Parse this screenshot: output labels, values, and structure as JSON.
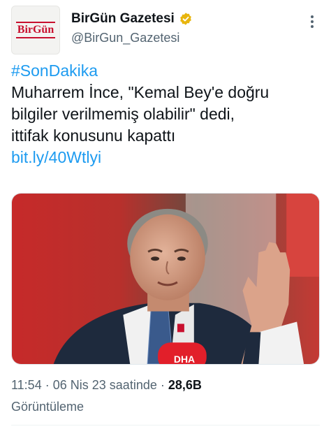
{
  "account": {
    "avatar_text": "BirGün",
    "display_name": "BirGün Gazetesi",
    "handle": "@BirGun_Gazetesi",
    "verified_color": "#e8b50d"
  },
  "tweet": {
    "hashtag": "#SonDakika",
    "lines": [
      "Muharrem İnce, \"Kemal Bey'e doğru",
      "bilgiler verilmemiş olabilir\" dedi,",
      "ittifak konusunu kapattı"
    ],
    "link": "bit.ly/40Wtlyi"
  },
  "media": {
    "mic_label": "DHA"
  },
  "meta": {
    "time": "11:54",
    "separator": "·",
    "date": "06 Nis 23 saatinde",
    "views_count": "28,6B",
    "views_label": "Görüntüleme"
  },
  "colors": {
    "link": "#1d9bf0",
    "secondary_text": "#536471",
    "brand_red": "#c8102e"
  }
}
